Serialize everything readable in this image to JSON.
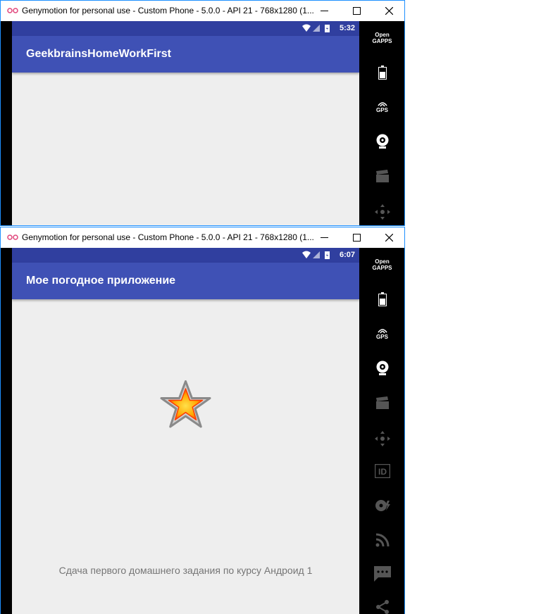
{
  "window1": {
    "title": "Genymotion for personal use - Custom Phone - 5.0.0 - API 21 - 768x1280 (1...",
    "status_time": "5:32",
    "app_title": "GeekbrainsHomeWorkFirst"
  },
  "window2": {
    "title": "Genymotion for personal use - Custom Phone - 5.0.0 - API 21 - 768x1280 (1...",
    "status_time": "6:07",
    "app_title": "Мое погодное приложение",
    "caption": "Сдача первого домашнего задания по курсу Андроид 1"
  },
  "sidebar": {
    "gapps_line1": "Open",
    "gapps_line2": "GAPPS",
    "gps_label": "GPS",
    "tools1": [
      "open-gapps-icon",
      "battery-icon",
      "gps-icon",
      "camera-icon",
      "video-capture-icon",
      "dpad-icon"
    ],
    "tools2": [
      "open-gapps-icon",
      "battery-icon",
      "gps-icon",
      "camera-icon",
      "video-capture-icon",
      "dpad-icon",
      "id-icon",
      "disk-icon",
      "rss-icon",
      "message-icon",
      "share-icon"
    ]
  },
  "colors": {
    "primary": "#3f51b5",
    "primary_dark": "#303f9f",
    "background": "#eeeeee",
    "window_border": "#1e90ff"
  }
}
